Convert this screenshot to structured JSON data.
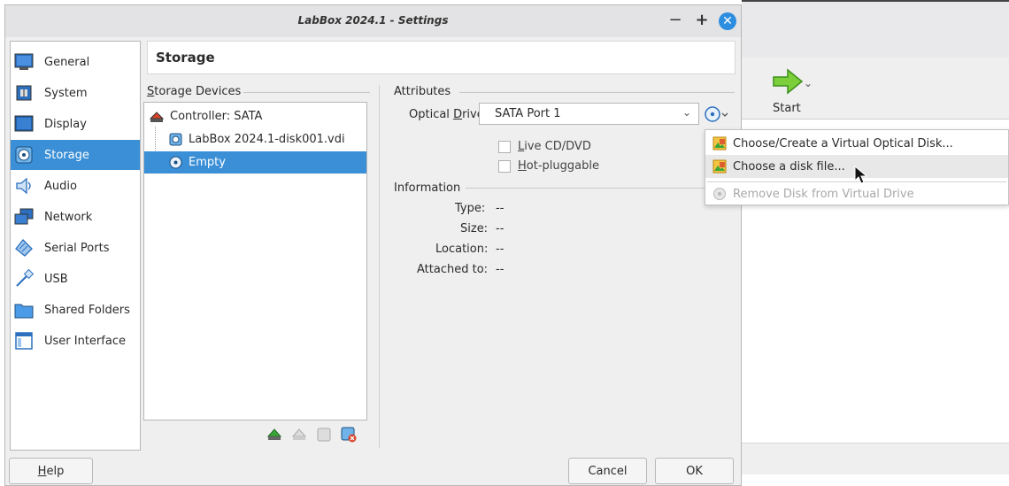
{
  "dialog": {
    "title": "LabBox 2024.1 - Settings",
    "minimize": "−",
    "maximize": "+",
    "close": "✕"
  },
  "sidebar": {
    "items": [
      {
        "label": "General",
        "icon": "monitor-icon"
      },
      {
        "label": "System",
        "icon": "chip-icon"
      },
      {
        "label": "Display",
        "icon": "display-icon"
      },
      {
        "label": "Storage",
        "icon": "storage-icon",
        "selected": true
      },
      {
        "label": "Audio",
        "icon": "speaker-icon"
      },
      {
        "label": "Network",
        "icon": "network-icon"
      },
      {
        "label": "Serial Ports",
        "icon": "serial-port-icon"
      },
      {
        "label": "USB",
        "icon": "usb-icon"
      },
      {
        "label": "Shared Folders",
        "icon": "folder-icon"
      },
      {
        "label": "User Interface",
        "icon": "window-icon"
      }
    ]
  },
  "page": {
    "title": "Storage"
  },
  "storage_devices": {
    "group_title": "Storage Devices",
    "controller": "Controller: SATA",
    "disk": "LabBox 2024.1-disk001.vdi",
    "optical": "Empty"
  },
  "attributes": {
    "group_title": "Attributes",
    "optical_drive_label": "Optical Drive:",
    "optical_drive_value": "SATA Port 1",
    "live_cd": "Live CD/DVD",
    "hot_pluggable": "Hot-pluggable"
  },
  "information": {
    "group_title": "Information",
    "type_label": "Type:",
    "type_value": "--",
    "size_label": "Size:",
    "size_value": "--",
    "location_label": "Location:",
    "location_value": "--",
    "attached_label": "Attached to:",
    "attached_value": "--"
  },
  "menu": {
    "items": [
      {
        "label": "Choose/Create a Virtual Optical Disk...",
        "enabled": true
      },
      {
        "label": "Choose a disk file...",
        "enabled": true,
        "hover": true
      },
      {
        "label": "Remove Disk from Virtual Drive",
        "enabled": false
      }
    ]
  },
  "buttons": {
    "help": "Help",
    "cancel": "Cancel",
    "ok": "OK"
  },
  "background_window": {
    "start_label": "Start"
  },
  "colors": {
    "accent": "#3a8fd6",
    "dialog_bg": "#efefef",
    "close_button": "#2d8ee0"
  }
}
